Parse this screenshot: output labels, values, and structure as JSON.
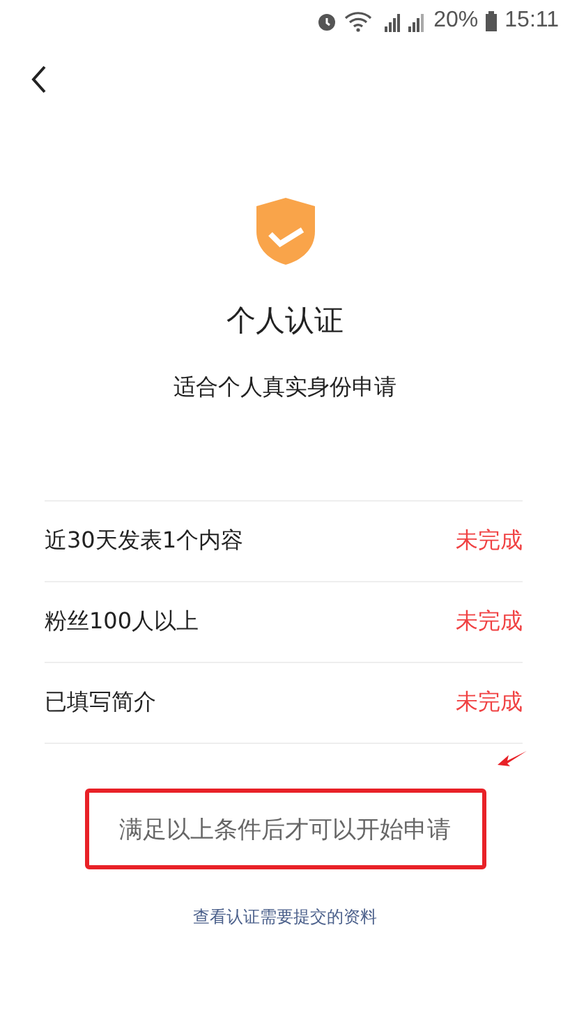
{
  "status_bar": {
    "battery": "20%",
    "time": "15:11"
  },
  "title": "个人认证",
  "subtitle": "适合个人真实身份申请",
  "requirements": [
    {
      "label": "近30天发表1个内容",
      "status": "未完成",
      "completed": false
    },
    {
      "label": "粉丝100人以上",
      "status": "未完成",
      "completed": false
    },
    {
      "label": "已填写简介",
      "status": "未完成",
      "completed": false
    }
  ],
  "apply_button": {
    "label": "满足以上条件后才可以开始申请",
    "disabled": true
  },
  "materials_link": "查看认证需要提交的资料"
}
